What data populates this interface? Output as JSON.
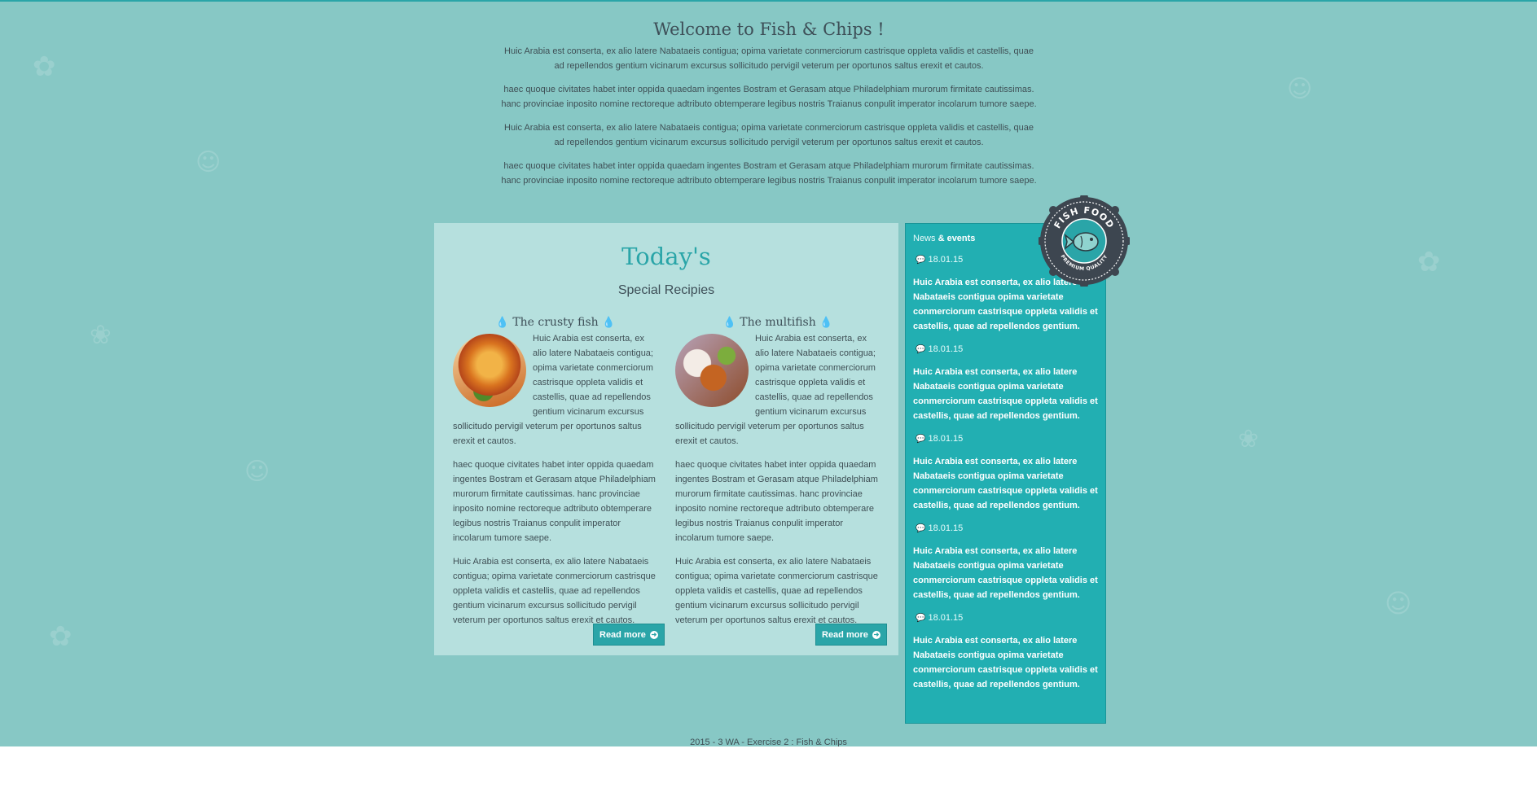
{
  "intro": {
    "title": "Welcome to Fish & Chips !",
    "paragraphs": [
      "Huic Arabia est conserta, ex alio latere Nabataeis contigua; opima varietate conmerciorum castrisque oppleta validis et castellis, quae ad repellendos gentium vicinarum excursus sollicitudo pervigil veterum per oportunos saltus erexit et cautos.",
      "haec quoque civitates habet inter oppida quaedam ingentes Bostram et Gerasam atque Philadelphiam murorum firmitate cautissimas. hanc provinciae inposito nomine rectoreque adtributo obtemperare legibus nostris Traianus conpulit imperator incolarum tumore saepe.",
      "Huic Arabia est conserta, ex alio latere Nabataeis contigua; opima varietate conmerciorum castrisque oppleta validis et castellis, quae ad repellendos gentium vicinarum excursus sollicitudo pervigil veterum per oportunos saltus erexit et cautos.",
      "haec quoque civitates habet inter oppida quaedam ingentes Bostram et Gerasam atque Philadelphiam murorum firmitate cautissimas. hanc provinciae inposito nomine rectoreque adtributo obtemperare legibus nostris Traianus conpulit imperator incolarum tumore saepe."
    ]
  },
  "special": {
    "title": "Today's",
    "subtitle": "Special Recipies",
    "recipes": [
      {
        "name": "The crusty fish",
        "photo_icon": "fried-fish-photo",
        "paragraphs": [
          "Huic Arabia est conserta, ex alio latere Nabataeis contigua; opima varietate conmerciorum castrisque oppleta validis et castellis, quae ad repellendos gentium vicinarum excursus sollicitudo pervigil veterum per oportunos saltus erexit et cautos.",
          "haec quoque civitates habet inter oppida quaedam ingentes Bostram et Gerasam atque Philadelphiam murorum firmitate cautissimas. hanc provinciae inposito nomine rectoreque adtributo obtemperare legibus nostris Traianus conpulit imperator incolarum tumore saepe.",
          "Huic Arabia est conserta, ex alio latere Nabataeis contigua; opima varietate conmerciorum castrisque oppleta validis et castellis, quae ad repellendos gentium vicinarum excursus sollicitudo pervigil veterum per oportunos saltus erexit et cautos."
        ],
        "button": "Read more"
      },
      {
        "name": "The multifish",
        "photo_icon": "seafood-platter-photo",
        "paragraphs": [
          "Huic Arabia est conserta, ex alio latere Nabataeis contigua; opima varietate conmerciorum castrisque oppleta validis et castellis, quae ad repellendos gentium vicinarum excursus sollicitudo pervigil veterum per oportunos saltus erexit et cautos.",
          "haec quoque civitates habet inter oppida quaedam ingentes Bostram et Gerasam atque Philadelphiam murorum firmitate cautissimas. hanc provinciae inposito nomine rectoreque adtributo obtemperare legibus nostris Traianus conpulit imperator incolarum tumore saepe.",
          "Huic Arabia est conserta, ex alio latere Nabataeis contigua; opima varietate conmerciorum castrisque oppleta validis et castellis, quae ad repellendos gentium vicinarum excursus sollicitudo pervigil veterum per oportunos saltus erexit et cautos."
        ],
        "button": "Read more"
      }
    ]
  },
  "news": {
    "heading_part1": "News",
    "heading_part2": " & events",
    "items": [
      {
        "date": "18.01.15",
        "text": "Huic Arabia est conserta, ex alio latere Nabataeis contigua opima varietate conmerciorum castrisque oppleta validis et castellis, quae ad repellendos gentium."
      },
      {
        "date": "18.01.15",
        "text": "Huic Arabia est conserta, ex alio latere Nabataeis contigua opima varietate conmerciorum castrisque oppleta validis et castellis, quae ad repellendos gentium."
      },
      {
        "date": "18.01.15",
        "text": "Huic Arabia est conserta, ex alio latere Nabataeis contigua opima varietate conmerciorum castrisque oppleta validis et castellis, quae ad repellendos gentium."
      },
      {
        "date": "18.01.15",
        "text": "Huic Arabia est conserta, ex alio latere Nabataeis contigua opima varietate conmerciorum castrisque oppleta validis et castellis, quae ad repellendos gentium."
      },
      {
        "date": "18.01.15",
        "text": "Huic Arabia est conserta, ex alio latere Nabataeis contigua opima varietate conmerciorum castrisque oppleta validis et castellis, quae ad repellendos gentium."
      }
    ]
  },
  "badge": {
    "top_text": "FISH FOOD",
    "bottom_text": "PREMIUM QUALITY",
    "icon": "fish-icon"
  },
  "footer": {
    "text": "2015 - 3 WA - Exercise 2 : Fish & Chips"
  },
  "colors": {
    "background": "#87c8c5",
    "accent": "#2aa5a8",
    "panel": "#b6e0de",
    "news_panel": "#22afb2",
    "badge_dark": "#3d4650"
  },
  "icons": {
    "drop": "water-drop-icon",
    "comment": "speech-bubble-icon",
    "arrow": "circle-arrow-right-icon"
  }
}
